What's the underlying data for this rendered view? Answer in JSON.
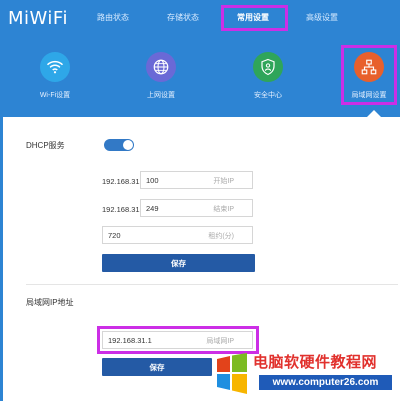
{
  "header": {
    "logo": "MiWiFi",
    "nav": [
      {
        "label": "路由状态"
      },
      {
        "label": "存储状态"
      },
      {
        "label": "常用设置"
      },
      {
        "label": "高级设置"
      }
    ],
    "active_nav": "常用设置"
  },
  "icon_nav": [
    {
      "label": "Wi-Fi设置",
      "icon": "wifi-icon",
      "color": "#2ea7e8"
    },
    {
      "label": "上网设置",
      "icon": "globe-icon",
      "color": "#6a69d6"
    },
    {
      "label": "安全中心",
      "icon": "shield-icon",
      "color": "#2fa55a"
    },
    {
      "label": "局域网设置",
      "icon": "network-icon",
      "color": "#e8602c"
    }
  ],
  "dhcp": {
    "title": "DHCP服务",
    "enabled": true,
    "start_prefix": "192.168.31.",
    "start_value": "100",
    "start_placeholder": "开始IP",
    "end_prefix": "192.168.31.",
    "end_value": "249",
    "end_placeholder": "结束IP",
    "lease_value": "720",
    "lease_placeholder": "租约(分)",
    "save_label": "保存"
  },
  "lan": {
    "title": "局域网IP地址",
    "ip_value": "192.168.31.1",
    "ip_placeholder": "局域网IP",
    "save_label": "保存"
  },
  "watermark": {
    "title": "电脑软硬件教程网",
    "url": "www.computer26.com"
  },
  "colors": {
    "header_bg": "#2d84d3",
    "highlight": "#cc2ee6",
    "button": "#245aa5",
    "toggle_on": "#3279c6"
  }
}
